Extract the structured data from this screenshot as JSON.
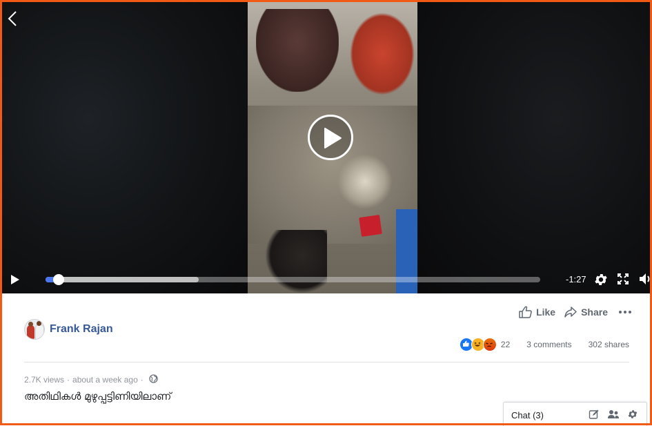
{
  "video": {
    "time_remaining": "-1:27",
    "played_fraction": 0.027,
    "buffered_fraction": 0.31
  },
  "post": {
    "author": "Frank Rajan",
    "like_label": "Like",
    "share_label": "Share",
    "reaction_count": "22",
    "comments": "3 comments",
    "shares": "302 shares",
    "views": "2.7K views",
    "time": "about a week ago",
    "separator": "·",
    "caption": "അതിഥികൾ മുഴുപ്പട്ടിണിയിലാണ്"
  },
  "chat": {
    "label": "Chat (3)"
  },
  "icons": {
    "reactions": [
      "like-reaction-icon",
      "haha-reaction-icon",
      "angry-reaction-icon"
    ],
    "colors": {
      "accent": "#365899",
      "progress": "#4a76f0",
      "border": "#f05a14"
    }
  }
}
